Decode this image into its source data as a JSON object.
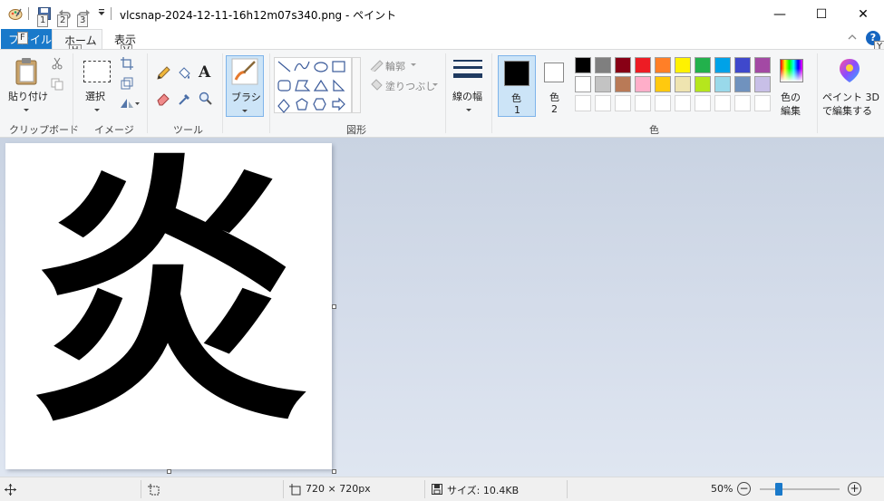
{
  "titlebar": {
    "title": "vlcsnap-2024-12-11-16h12m07s340.png - ペイント",
    "keytips": [
      "1",
      "2",
      "3"
    ],
    "minimize_glyph": "—",
    "maximize_glyph": "☐",
    "close_glyph": "✕"
  },
  "tabs": {
    "file": "ファイル",
    "file_keytip": "F",
    "home": "ホーム",
    "home_keytip": "H",
    "view": "表示",
    "view_keytip": "V",
    "help_keytip": "Y"
  },
  "ribbon": {
    "clipboard": {
      "paste_label": "貼り付け",
      "group_label": "クリップボード"
    },
    "image": {
      "select_label": "選択",
      "group_label": "イメージ"
    },
    "tools": {
      "group_label": "ツール"
    },
    "brushes": {
      "label": "ブラシ"
    },
    "shapes": {
      "outline_label": "輪郭",
      "fill_label": "塗りつぶし",
      "group_label": "図形"
    },
    "size": {
      "label": "線の幅"
    },
    "colors": {
      "color1_label": "色",
      "color1_num": "1",
      "color2_label": "色",
      "color2_num": "2",
      "edit_colors_line1": "色の",
      "edit_colors_line2": "編集",
      "group_label": "色",
      "color1_value": "#000000",
      "color2_value": "#ffffff",
      "palette_row1": [
        "#000000",
        "#7f7f7f",
        "#880015",
        "#ed1c24",
        "#ff7f27",
        "#fff200",
        "#22b14c",
        "#00a2e8",
        "#3f48cc",
        "#a349a4"
      ],
      "palette_row2": [
        "#ffffff",
        "#c3c3c3",
        "#b97a57",
        "#ffaec9",
        "#ffc90e",
        "#efe4b0",
        "#b5e61d",
        "#99d9ea",
        "#7092be",
        "#c8bfe7"
      ]
    },
    "paint3d": {
      "line1": "ペイント 3D",
      "line2": "で編集する"
    }
  },
  "canvas": {
    "kanji": "炎"
  },
  "statusbar": {
    "dimensions": "720 × 720px",
    "size": "サイズ: 10.4KB",
    "zoom": "50%",
    "zoom_out": "−",
    "zoom_in": "+"
  }
}
